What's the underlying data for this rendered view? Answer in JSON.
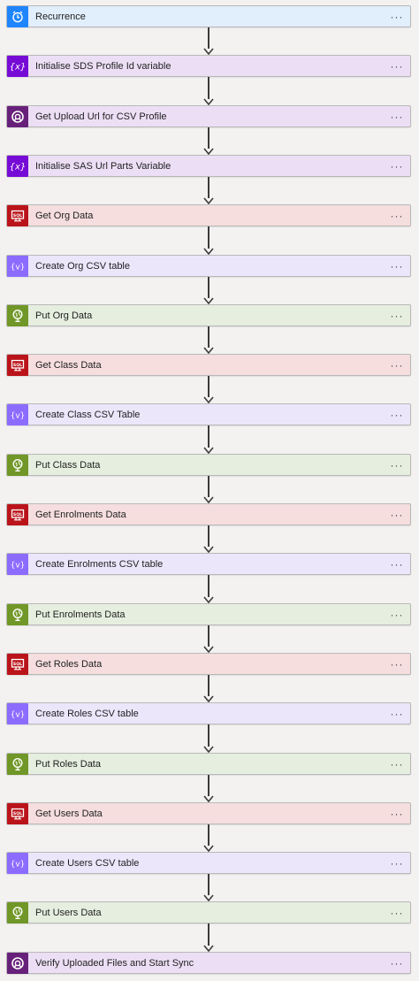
{
  "steps": [
    {
      "label": "Recurrence",
      "type": "recurrence",
      "icon": "clock-icon"
    },
    {
      "label": "Initialise SDS Profile Id variable",
      "type": "variable",
      "icon": "variable-icon"
    },
    {
      "label": "Get Upload Url for CSV Profile",
      "type": "connector",
      "icon": "gauge-icon"
    },
    {
      "label": "Initialise SAS Url Parts Variable",
      "type": "variable",
      "icon": "variable-icon"
    },
    {
      "label": "Get Org Data",
      "type": "sql",
      "icon": "sql-icon"
    },
    {
      "label": "Create Org CSV table",
      "type": "dataop",
      "icon": "data-operation-icon"
    },
    {
      "label": "Put Org Data",
      "type": "http",
      "icon": "globe-icon"
    },
    {
      "label": "Get Class Data",
      "type": "sql",
      "icon": "sql-icon"
    },
    {
      "label": "Create Class CSV Table",
      "type": "dataop",
      "icon": "data-operation-icon"
    },
    {
      "label": "Put Class Data",
      "type": "http",
      "icon": "globe-icon"
    },
    {
      "label": "Get Enrolments Data",
      "type": "sql",
      "icon": "sql-icon"
    },
    {
      "label": "Create Enrolments CSV table",
      "type": "dataop",
      "icon": "data-operation-icon"
    },
    {
      "label": "Put Enrolments Data",
      "type": "http",
      "icon": "globe-icon"
    },
    {
      "label": "Get Roles Data",
      "type": "sql",
      "icon": "sql-icon"
    },
    {
      "label": "Create Roles CSV table",
      "type": "dataop",
      "icon": "data-operation-icon"
    },
    {
      "label": "Put Roles Data",
      "type": "http",
      "icon": "globe-icon"
    },
    {
      "label": "Get Users Data",
      "type": "sql",
      "icon": "sql-icon"
    },
    {
      "label": "Create Users CSV table",
      "type": "dataop",
      "icon": "data-operation-icon"
    },
    {
      "label": "Put Users Data",
      "type": "http",
      "icon": "globe-icon"
    },
    {
      "label": "Verify Uploaded Files and Start Sync",
      "type": "connector",
      "icon": "gauge-icon"
    }
  ],
  "more_label": "···",
  "colors": {
    "recurrence": {
      "bg": "#e1eefb",
      "icon": "#1f85ff"
    },
    "variable": {
      "bg": "#ecdff5",
      "icon": "#770bd6"
    },
    "connector": {
      "bg": "#ecdff5",
      "icon": "#68217a"
    },
    "sql": {
      "bg": "#f6dede",
      "icon": "#ba141a"
    },
    "dataop": {
      "bg": "#ece6fb",
      "icon": "#8c6cff"
    },
    "http": {
      "bg": "#e6eedf",
      "icon": "#709727"
    }
  }
}
